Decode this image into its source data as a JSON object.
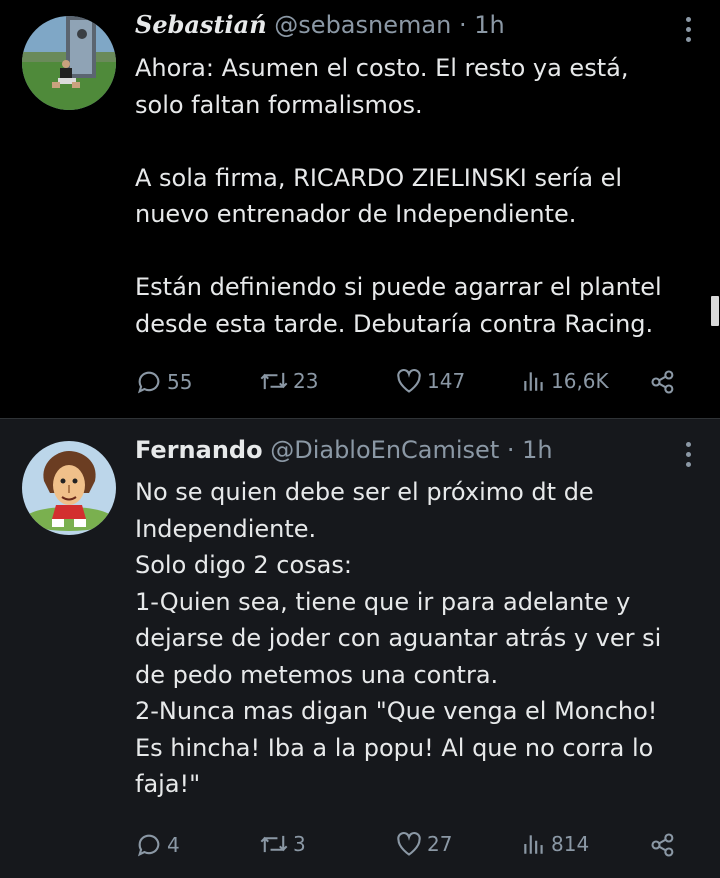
{
  "tweets": [
    {
      "name": "Sebastiań",
      "handle": "@sebasneman",
      "separator": "·",
      "time": "1h",
      "text": [
        "Ahora: Asumen el costo. El resto ya está,",
        "solo faltan formalismos.",
        "A sola firma, RICARDO ZIELINSKI sería el",
        "nuevo entrenador de Independiente.",
        "Están definiendo si puede agarrar el plantel",
        "desde esta tarde. Debutaría contra Racing."
      ],
      "replies": "55",
      "retweets": "23",
      "likes": "147",
      "views": "16,6K"
    },
    {
      "name": "Fernando",
      "handle": "@DiabloEnCamiset",
      "separator": "·",
      "time": "1h",
      "text": [
        "No se quien debe ser el próximo dt de",
        "Independiente.",
        "Solo digo 2 cosas:",
        "1-Quien sea, tiene que ir para adelante y",
        "dejarse de joder con aguantar atrás y ver si",
        "de pedo metemos una contra.",
        "2-Nunca mas digan \"Que venga el Moncho!",
        "Es hincha! Iba a la popu! Al que no corra lo",
        "faja!\""
      ],
      "replies": "4",
      "retweets": "3",
      "likes": "27",
      "views": "814"
    }
  ],
  "icons": {
    "reply": "reply-icon",
    "retweet": "retweet-icon",
    "like": "heart-icon",
    "views": "views-icon",
    "share": "share-icon",
    "more": "more-icon"
  },
  "colors": {
    "background": "#000000",
    "reply_background": "#16181c",
    "text": "#e7e9ea",
    "secondary": "#8b98a5"
  }
}
